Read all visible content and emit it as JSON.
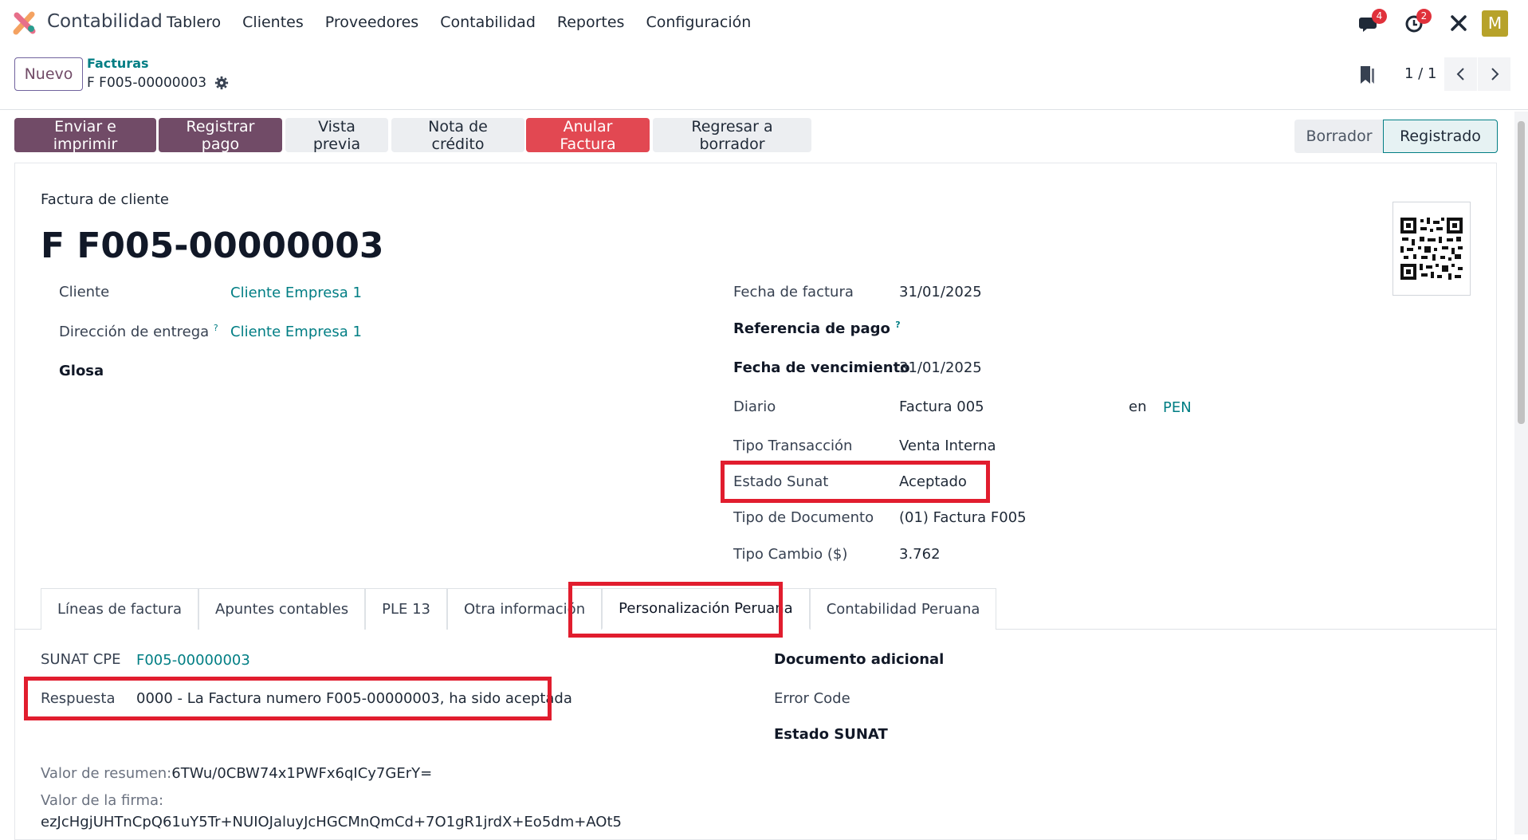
{
  "app": {
    "name": "Contabilidad",
    "menu": [
      "Tablero",
      "Clientes",
      "Proveedores",
      "Contabilidad",
      "Reportes",
      "Configuración"
    ],
    "badges": {
      "messages": "4",
      "activities": "2"
    },
    "avatar_letter": "M"
  },
  "control": {
    "new_label": "Nuevo",
    "breadcrumb_parent": "Facturas",
    "breadcrumb_current": "F F005-00000003",
    "pager_value": "1 / 1"
  },
  "actions": {
    "send_print": "Enviar e imprimir",
    "register_payment": "Registrar pago",
    "preview": "Vista previa",
    "credit_note": "Nota de crédito",
    "cancel_invoice": "Anular Factura",
    "reset_draft": "Regresar a borrador"
  },
  "stages": {
    "draft": "Borrador",
    "posted": "Registrado",
    "current": "Registrado"
  },
  "invoice": {
    "kind": "Factura de cliente",
    "name": "F F005-00000003",
    "left": {
      "client_label": "Cliente",
      "client_value": "Cliente Empresa 1",
      "delivery_label": "Dirección de entrega",
      "delivery_value": "Cliente Empresa 1",
      "glosa_label": "Glosa"
    },
    "right": {
      "invoice_date_label": "Fecha de factura",
      "invoice_date_value": "31/01/2025",
      "payment_ref_label": "Referencia de pago",
      "due_date_label": "Fecha de vencimiento",
      "due_date_value": "31/01/2025",
      "journal_label": "Diario",
      "journal_value": "Factura 005",
      "currency_prefix": "en",
      "currency_value": "PEN",
      "transaction_label": "Tipo Transacción",
      "transaction_value": "Venta Interna",
      "sunat_state_label": "Estado Sunat",
      "sunat_state_value": "Aceptado",
      "doc_type_label": "Tipo de Documento",
      "doc_type_value": "(01) Factura F005",
      "exchange_label": "Tipo Cambio ($)",
      "exchange_value": "3.762"
    },
    "help_mark": "?"
  },
  "tabs": [
    "Líneas de factura",
    "Apuntes contables",
    "PLE 13",
    "Otra información",
    "Personalización Peruana",
    "Contabilidad Peruana"
  ],
  "active_tab": "Personalización Peruana",
  "peru": {
    "cpe_label": "SUNAT CPE",
    "cpe_value": "F005-00000003",
    "response_label": "Respuesta",
    "response_value": "0000 - La Factura numero F005-00000003, ha sido aceptada",
    "summary_label": "Valor de resumen:",
    "summary_value": "6TWu/0CBW74x1PWFx6qICy7GErY=",
    "signature_label": "Valor de la firma:",
    "signature_value": "ezJcHgjUHTnCpQ61uY5Tr+NUIOJaluyJcHGCMnQmCd+7O1gR1jrdX+Eo5dm+AOt5",
    "extra_doc_label": "Documento adicional",
    "error_code_label": "Error Code",
    "sunat_state_label": "Estado SUNAT"
  },
  "colors": {
    "brand": "#714b67",
    "link": "#017e84",
    "danger": "#e24852",
    "highlight": "#e11d2e"
  }
}
